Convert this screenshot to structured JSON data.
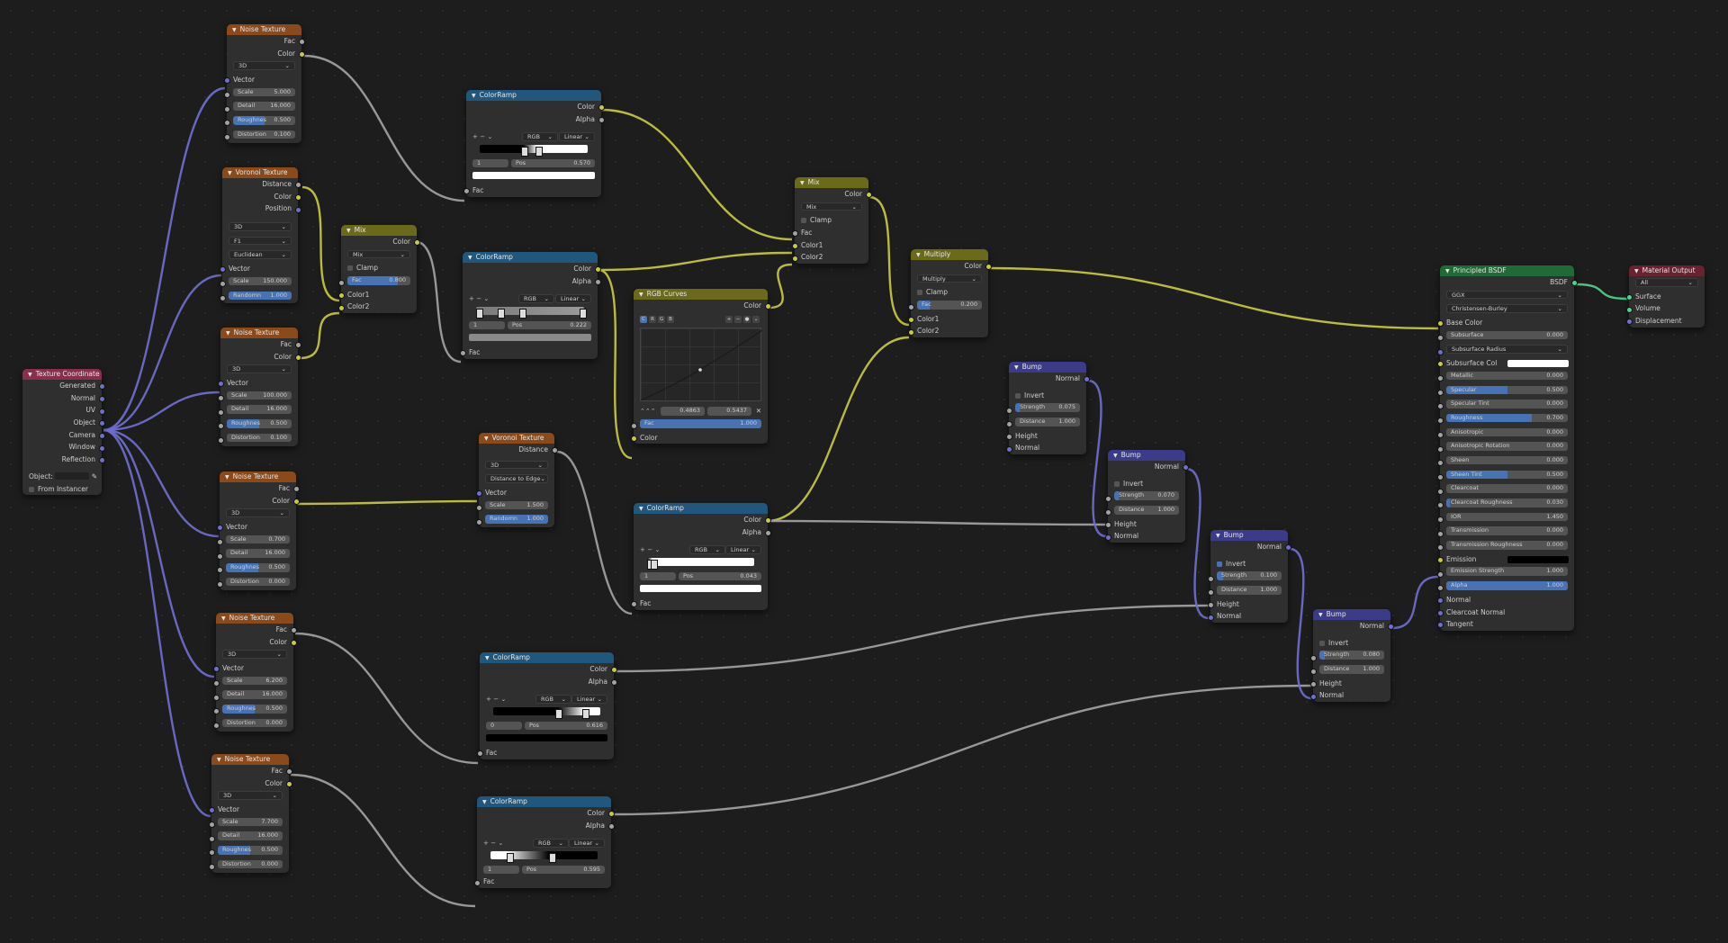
{
  "nodes": {
    "noise1": {
      "title": "Noise Texture",
      "fac": "Fac",
      "color": "Color",
      "dim": "3D",
      "vector": "Vector",
      "scale_l": "Scale",
      "scale_v": "5.000",
      "detail_l": "Detail",
      "detail_v": "16.000",
      "rough_l": "Roughnes",
      "rough_v": "0.500",
      "rough_f": 0.5,
      "dist_l": "Distortion",
      "dist_v": "0.100"
    },
    "vor1": {
      "title": "Voronoi Texture",
      "distance": "Distance",
      "color": "Color",
      "position": "Position",
      "dim": "3D",
      "feature": "F1",
      "metric": "Euclidean",
      "vector": "Vector",
      "scale_l": "Scale",
      "scale_v": "150.000",
      "rand_l": "Randomn",
      "rand_v": "1.000",
      "rand_f": 1
    },
    "noise2": {
      "title": "Noise Texture",
      "fac": "Fac",
      "color": "Color",
      "dim": "3D",
      "vector": "Vector",
      "scale_l": "Scale",
      "scale_v": "100.000",
      "detail_l": "Detail",
      "detail_v": "16.000",
      "rough_l": "Roughnes",
      "rough_v": "0.500",
      "rough_f": 0.5,
      "dist_l": "Distortion",
      "dist_v": "0.100"
    },
    "noise3": {
      "title": "Noise Texture",
      "fac": "Fac",
      "color": "Color",
      "dim": "3D",
      "vector": "Vector",
      "scale_l": "Scale",
      "scale_v": "0.700",
      "detail_l": "Detail",
      "detail_v": "16.000",
      "rough_l": "Roughnes",
      "rough_v": "0.500",
      "rough_f": 0.5,
      "dist_l": "Distortion",
      "dist_v": "0.000"
    },
    "noise4": {
      "title": "Noise Texture",
      "fac": "Fac",
      "color": "Color",
      "dim": "3D",
      "vector": "Vector",
      "scale_l": "Scale",
      "scale_v": "6.200",
      "detail_l": "Detail",
      "detail_v": "16.000",
      "rough_l": "Roughnes",
      "rough_v": "0.500",
      "rough_f": 0.5,
      "dist_l": "Distortion",
      "dist_v": "0.000"
    },
    "noise5": {
      "title": "Noise Texture",
      "fac": "Fac",
      "color": "Color",
      "dim": "3D",
      "vector": "Vector",
      "scale_l": "Scale",
      "scale_v": "7.700",
      "detail_l": "Detail",
      "detail_v": "16.000",
      "rough_l": "Roughnes",
      "rough_v": "0.500",
      "rough_f": 0.5,
      "dist_l": "Distortion",
      "dist_v": "0.000"
    },
    "texcoord": {
      "title": "Texture Coordinate",
      "generated": "Generated",
      "normal": "Normal",
      "uv": "UV",
      "object": "Object",
      "camera": "Camera",
      "window": "Window",
      "reflection": "Reflection",
      "object_field": "Object:",
      "from_instancer": "From Instancer"
    },
    "mix1": {
      "title": "Mix",
      "color": "Color",
      "mode": "Mix",
      "clamp": "Clamp",
      "fac_l": "Fac",
      "fac_v": "0.800",
      "fac_f": 0.8,
      "color1": "Color1",
      "color2": "Color2"
    },
    "ramp1": {
      "title": "ColorRamp",
      "color": "Color",
      "alpha": "Alpha",
      "mode": "RGB",
      "interp": "Linear",
      "idx": "1",
      "pos_l": "Pos",
      "pos_v": "0.570",
      "fac": "Fac"
    },
    "ramp2": {
      "title": "ColorRamp",
      "color": "Color",
      "alpha": "Alpha",
      "mode": "RGB",
      "interp": "Linear",
      "idx": "1",
      "pos_l": "Pos",
      "pos_v": "0.222",
      "fac": "Fac"
    },
    "vor2": {
      "title": "Voronoi Texture",
      "distance": "Distance",
      "dim": "3D",
      "feature": "Distance to Edge",
      "vector": "Vector",
      "scale_l": "Scale",
      "scale_v": "1.500",
      "rand_l": "Randomn",
      "rand_v": "1.000",
      "rand_f": 1
    },
    "ramp3": {
      "title": "ColorRamp",
      "color": "Color",
      "alpha": "Alpha",
      "mode": "RGB",
      "interp": "Linear",
      "idx": "0",
      "pos_l": "Pos",
      "pos_v": "0.616",
      "fac": "Fac"
    },
    "ramp4": {
      "title": "ColorRamp",
      "color": "Color",
      "alpha": "Alpha",
      "mode": "RGB",
      "interp": "Linear",
      "idx": "1",
      "pos_l": "Pos",
      "pos_v": "0.595",
      "fac": "Fac"
    },
    "curves": {
      "title": "RGB Curves",
      "color": "Color",
      "tabs": [
        "C",
        "R",
        "G",
        "B"
      ],
      "x_v": "0.4863",
      "y_v": "0.5437",
      "fac_l": "Fac",
      "fac_v": "1.000",
      "fac_f": 1,
      "color_in": "Color"
    },
    "ramp5": {
      "title": "ColorRamp",
      "color": "Color",
      "alpha": "Alpha",
      "mode": "RGB",
      "interp": "Linear",
      "idx": "1",
      "pos_l": "Pos",
      "pos_v": "0.043",
      "fac": "Fac"
    },
    "mix2": {
      "title": "Mix",
      "color": "Color",
      "mode": "Mix",
      "clamp": "Clamp",
      "fac": "Fac",
      "color1": "Color1",
      "color2": "Color2"
    },
    "multiply": {
      "title": "Multiply",
      "color": "Color",
      "mode": "Multiply",
      "clamp": "Clamp",
      "fac_l": "Fac",
      "fac_v": "0.200",
      "fac_f": 0.2,
      "color1": "Color1",
      "color2": "Color2"
    },
    "bump1": {
      "title": "Bump",
      "normal": "Normal",
      "invert": "Invert",
      "strength_l": "Strength",
      "strength_v": "0.075",
      "strength_f": 0.075,
      "distance_l": "Distance",
      "distance_v": "1.000",
      "height": "Height",
      "normal_in": "Normal"
    },
    "bump2": {
      "title": "Bump",
      "normal": "Normal",
      "invert": "Invert",
      "strength_l": "Strength",
      "strength_v": "0.070",
      "strength_f": 0.07,
      "distance_l": "Distance",
      "distance_v": "1.000",
      "height": "Height",
      "normal_in": "Normal"
    },
    "bump3": {
      "title": "Bump",
      "normal": "Normal",
      "invert": "Invert",
      "strength_l": "Strength",
      "strength_v": "0.100",
      "strength_f": 0.1,
      "distance_l": "Distance",
      "distance_v": "1.000",
      "height": "Height",
      "normal_in": "Normal"
    },
    "bump4": {
      "title": "Bump",
      "normal": "Normal",
      "invert": "Invert",
      "strength_l": "Strength",
      "strength_v": "0.080",
      "strength_f": 0.08,
      "distance_l": "Distance",
      "distance_v": "1.000",
      "height": "Height",
      "normal_in": "Normal"
    },
    "bsdf": {
      "title": "Principled BSDF",
      "bsdf": "BSDF",
      "dist": "GGX",
      "sss_method": "Christensen-Burley",
      "base_color": "Base Color",
      "params": [
        {
          "l": "Subsurface",
          "v": "0.000",
          "f": 0
        },
        {
          "l": "Subsurface Radius",
          "v": "",
          "f": 0,
          "sel": true
        },
        {
          "l": "Subsurface Col",
          "v": "",
          "f": 0,
          "col": "#ffffff"
        },
        {
          "l": "Metallic",
          "v": "0.000",
          "f": 0
        },
        {
          "l": "Specular",
          "v": "0.500",
          "f": 0.5
        },
        {
          "l": "Specular Tint",
          "v": "0.000",
          "f": 0
        },
        {
          "l": "Roughness",
          "v": "0.700",
          "f": 0.7
        },
        {
          "l": "Anisotropic",
          "v": "0.000",
          "f": 0
        },
        {
          "l": "Anisotropic Rotation",
          "v": "0.000",
          "f": 0
        },
        {
          "l": "Sheen",
          "v": "0.000",
          "f": 0
        },
        {
          "l": "Sheen Tint",
          "v": "0.500",
          "f": 0.5
        },
        {
          "l": "Clearcoat",
          "v": "0.000",
          "f": 0
        },
        {
          "l": "Clearcoat Roughness",
          "v": "0.030",
          "f": 0.03
        },
        {
          "l": "IOR",
          "v": "1.450",
          "f": 0
        },
        {
          "l": "Transmission",
          "v": "0.000",
          "f": 0
        },
        {
          "l": "Transmission Roughness",
          "v": "0.000",
          "f": 0
        },
        {
          "l": "Emission",
          "v": "",
          "f": 0,
          "col": "#000000"
        },
        {
          "l": "Emission Strength",
          "v": "1.000",
          "f": 0
        },
        {
          "l": "Alpha",
          "v": "1.000",
          "f": 1
        }
      ],
      "normal": "Normal",
      "clearcoat_normal": "Clearcoat Normal",
      "tangent": "Tangent"
    },
    "output": {
      "title": "Material Output",
      "target": "All",
      "surface": "Surface",
      "volume": "Volume",
      "displacement": "Displacement"
    }
  },
  "colors": {
    "header_texture": "#8a4a1c",
    "header_converter": "#22577d",
    "header_color": "#6b6a1a",
    "header_shader": "#1f6a36",
    "header_vector": "#3b3b8a",
    "header_input": "#8a2f4b",
    "header_output": "#6a2230",
    "wire_color": "#c9c941",
    "wire_float": "#a3a3a3",
    "wire_vector": "#6f6fd0",
    "wire_shader": "#4fd18a",
    "field_active": "#4772b3"
  }
}
